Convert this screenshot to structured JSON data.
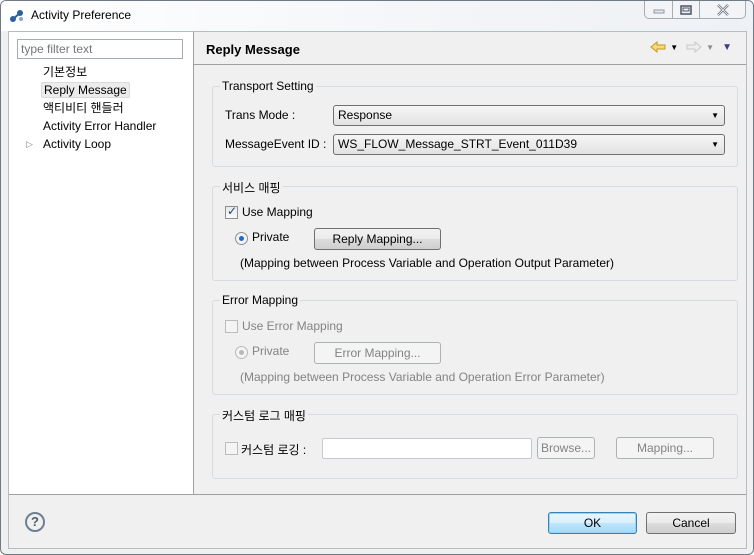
{
  "window": {
    "title": "Activity Preference",
    "controls": [
      "minimize",
      "maximize",
      "close"
    ]
  },
  "sidebar": {
    "filter_placeholder": "type filter text",
    "items": [
      {
        "label": "기본정보",
        "selected": false,
        "expandable": false
      },
      {
        "label": "Reply Message",
        "selected": true,
        "expandable": false
      },
      {
        "label": "액티비티 핸들러",
        "selected": false,
        "expandable": false
      },
      {
        "label": "Activity Error Handler",
        "selected": false,
        "expandable": false
      },
      {
        "label": "Activity Loop",
        "selected": false,
        "expandable": true
      }
    ]
  },
  "page": {
    "title": "Reply Message",
    "nav": {
      "back_icon": "back-arrow-icon",
      "forward_icon": "forward-arrow-icon",
      "menu_icon": "view-menu-icon"
    }
  },
  "transport": {
    "group_label": "Transport Setting",
    "trans_mode_label": "Trans Mode :",
    "trans_mode_value": "Response",
    "message_event_label": "MessageEvent ID :",
    "message_event_value": "WS_FLOW_Message_STRT_Event_011D39"
  },
  "service_mapping": {
    "group_label": "서비스 매핑",
    "use_mapping_label": "Use Mapping",
    "use_mapping_checked": true,
    "private_label": "Private",
    "private_selected": true,
    "button_label": "Reply Mapping...",
    "note": "(Mapping between Process Variable and Operation Output Parameter)"
  },
  "error_mapping": {
    "group_label": "Error Mapping",
    "use_mapping_label": "Use Error Mapping",
    "use_mapping_checked": false,
    "private_label": "Private",
    "private_selected": true,
    "button_label": "Error Mapping...",
    "note": "(Mapping between Process Variable and Operation Error Parameter)",
    "enabled": false
  },
  "custom_log": {
    "group_label": "커스텀 로그 매핑",
    "checkbox_label": "커스텀 로깅 :",
    "checked": false,
    "path_value": "",
    "browse_label": "Browse...",
    "mapping_label": "Mapping..."
  },
  "footer": {
    "help_label": "?",
    "ok_label": "OK",
    "cancel_label": "Cancel"
  }
}
